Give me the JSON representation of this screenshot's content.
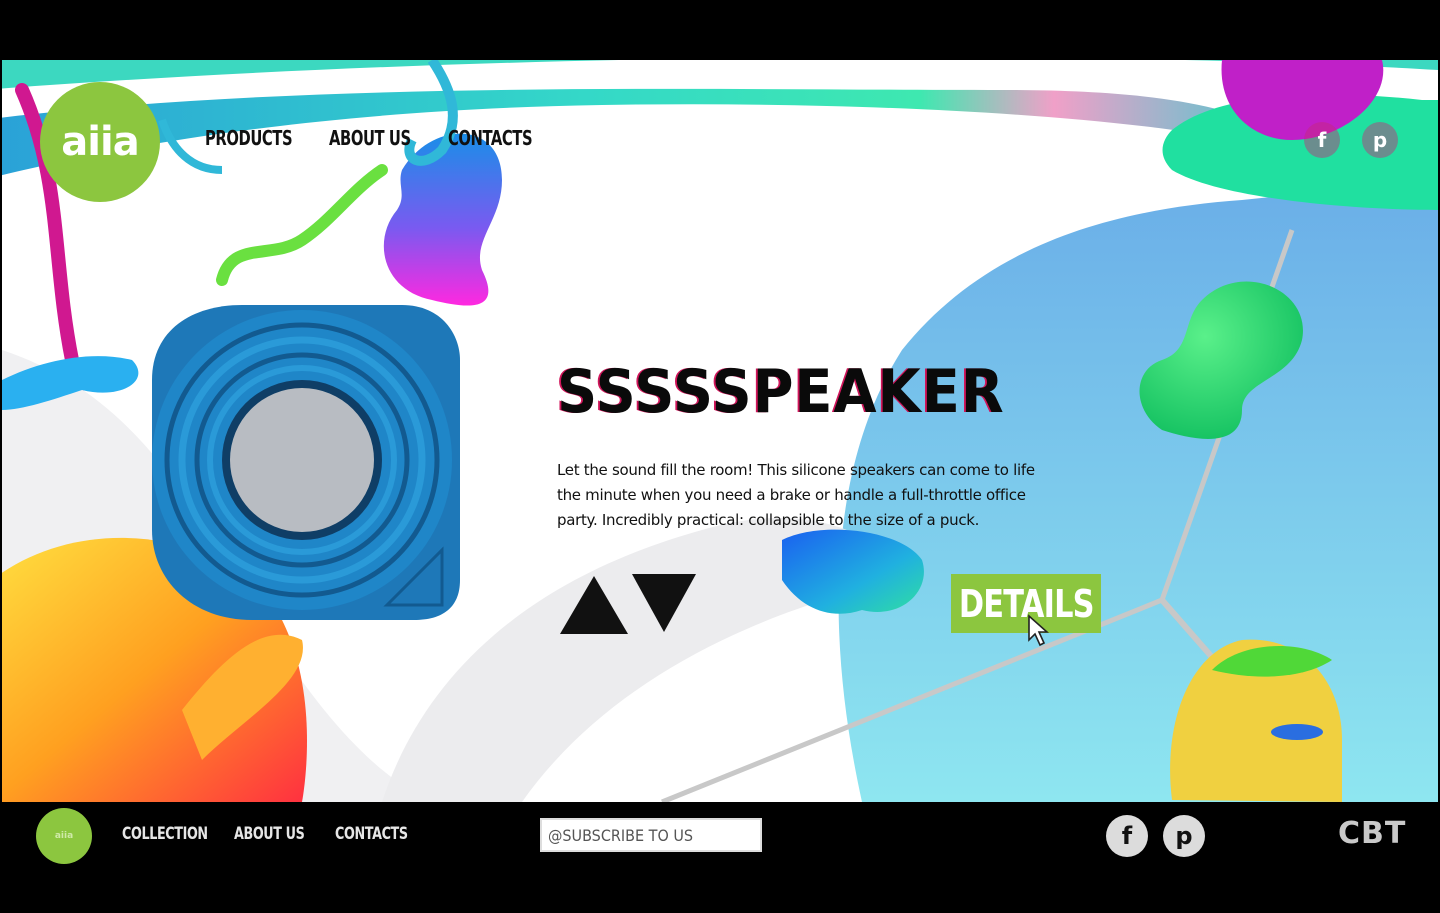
{
  "brand": {
    "logo_text": "aiia",
    "accent": "#8cc63f"
  },
  "nav": {
    "items": [
      "PRODUCTS",
      "ABOUT US",
      "CONTACTS"
    ]
  },
  "social": [
    "facebook-icon",
    "pinterest-icon"
  ],
  "hero": {
    "title": "SSSSSPEAKER",
    "description": "Let the sound fill the room! This silicone speakers can come to life the minute when you need a brake or handle a full-throttle office party. Incredibly practical: collapsible to the size of a puck.",
    "details_label": "DETAILS",
    "prev_icon": "triangle-up-icon",
    "next_icon": "triangle-down-icon"
  },
  "footer": {
    "nav": [
      "COLLECTION",
      "ABOUT US",
      "CONTACTS"
    ],
    "subscribe_placeholder": "@SUBSCRIBE TO US",
    "watermark": "CBT"
  }
}
